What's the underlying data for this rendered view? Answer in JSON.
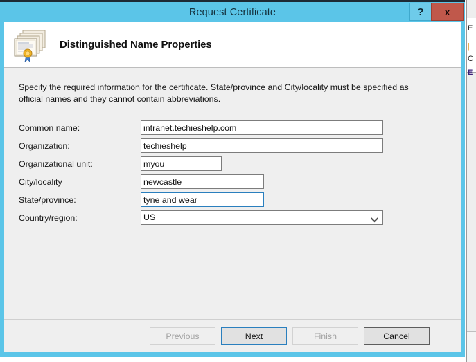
{
  "window": {
    "title": "Request Certificate",
    "help_label": "?",
    "close_label": "x"
  },
  "header": {
    "heading": "Distinguished Name Properties",
    "icon": "certificate-stack-icon"
  },
  "body": {
    "instructions": "Specify the required information for the certificate. State/province and City/locality must be specified as official names and they cannot contain abbreviations."
  },
  "form": {
    "fields": [
      {
        "label": "Common name:",
        "value": "intranet.techieshelp.com",
        "name": "common-name",
        "width": "wide",
        "type": "text",
        "focused": false
      },
      {
        "label": "Organization:",
        "value": "techieshelp",
        "name": "organization",
        "width": "wide",
        "type": "text",
        "focused": false
      },
      {
        "label": "Organizational unit:",
        "value": "myou",
        "name": "organizational-unit",
        "width": "small",
        "type": "text",
        "focused": false
      },
      {
        "label": "City/locality",
        "value": "newcastle",
        "name": "city-locality",
        "width": "medium",
        "type": "text",
        "focused": false
      },
      {
        "label": "State/province:",
        "value": "tyne and wear",
        "name": "state-province",
        "width": "medium",
        "type": "text",
        "focused": true
      },
      {
        "label": "Country/region:",
        "value": "US",
        "name": "country-region",
        "width": "wide",
        "type": "select",
        "focused": false
      }
    ]
  },
  "footer": {
    "buttons": [
      {
        "label": "Previous",
        "name": "previous-button",
        "state": "disabled"
      },
      {
        "label": "Next",
        "name": "next-button",
        "state": "default"
      },
      {
        "label": "Finish",
        "name": "finish-button",
        "state": "disabled"
      },
      {
        "label": "Cancel",
        "name": "cancel-button",
        "state": "normal"
      }
    ]
  },
  "background_window": {
    "glyph_1": "E",
    "glyph_2": "|",
    "glyph_3": "C",
    "glyph_4": "E"
  },
  "colors": {
    "titlebar": "#5bc5e8",
    "close_button": "#c0584b",
    "focus_border": "#2a7fbe",
    "body": "#efefef"
  }
}
